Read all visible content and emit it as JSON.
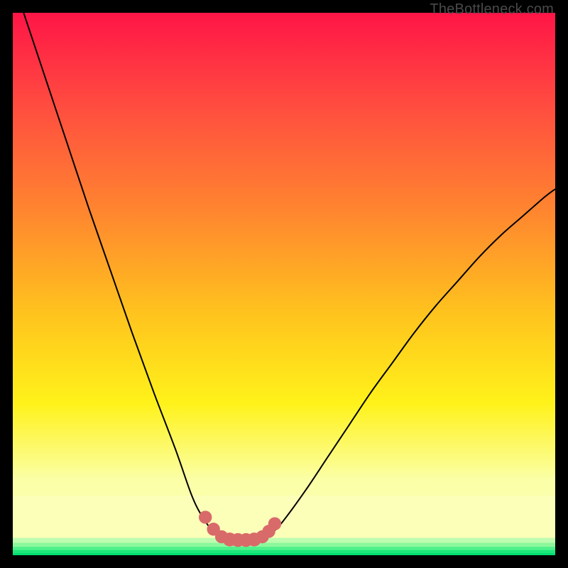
{
  "watermark": "TheBottleneck.com",
  "chart_data": {
    "type": "line",
    "title": "",
    "xlabel": "",
    "ylabel": "",
    "xlim": [
      0,
      100
    ],
    "ylim": [
      0,
      100
    ],
    "grid": false,
    "legend": false,
    "series": [
      {
        "name": "left-curve",
        "x": [
          2,
          6,
          10,
          14,
          18,
          22,
          26,
          30,
          33,
          35,
          37,
          38.5
        ],
        "y": [
          100,
          88,
          76,
          64,
          52.5,
          41,
          30,
          19.5,
          11,
          7,
          4.3,
          3.2
        ]
      },
      {
        "name": "right-curve",
        "x": [
          46,
          48,
          50,
          54,
          58,
          62,
          66,
          70,
          74,
          78,
          82,
          86,
          90,
          94,
          98,
          100
        ],
        "y": [
          3.2,
          4.3,
          6.5,
          12,
          18,
          24,
          30,
          35.5,
          41,
          46,
          50.5,
          55,
          59,
          62.5,
          66,
          67.5
        ]
      },
      {
        "name": "flat-bottom",
        "x": [
          38.5,
          40,
          41.5,
          43,
          44.5,
          46
        ],
        "y": [
          3.2,
          2.9,
          2.8,
          2.8,
          2.9,
          3.2
        ]
      }
    ],
    "markers": {
      "name": "bottom-dots",
      "color": "#d96a6a",
      "points": [
        {
          "x": 35.5,
          "y": 7.0,
          "r": 1.1
        },
        {
          "x": 37.0,
          "y": 4.8,
          "r": 1.1
        },
        {
          "x": 38.5,
          "y": 3.4,
          "r": 1.1
        },
        {
          "x": 40.0,
          "y": 2.9,
          "r": 1.25
        },
        {
          "x": 41.5,
          "y": 2.8,
          "r": 1.25
        },
        {
          "x": 43.0,
          "y": 2.8,
          "r": 1.25
        },
        {
          "x": 44.5,
          "y": 2.9,
          "r": 1.25
        },
        {
          "x": 46.0,
          "y": 3.4,
          "r": 1.1
        },
        {
          "x": 47.2,
          "y": 4.4,
          "r": 1.1
        },
        {
          "x": 48.3,
          "y": 5.8,
          "r": 1.1
        }
      ]
    },
    "bands": [
      {
        "name": "green-thin-1",
        "y0": 0.0,
        "y1": 0.5,
        "color": "#00df72"
      },
      {
        "name": "green-thin-2",
        "y0": 0.5,
        "y1": 1.0,
        "color": "#1de87a"
      },
      {
        "name": "green-thin-3",
        "y0": 1.0,
        "y1": 1.6,
        "color": "#4ff18b"
      },
      {
        "name": "green-thin-4",
        "y0": 1.6,
        "y1": 2.3,
        "color": "#8cf79b"
      },
      {
        "name": "green-thin-5",
        "y0": 2.3,
        "y1": 3.2,
        "color": "#befcb0"
      },
      {
        "name": "pale-yellow",
        "y0": 3.2,
        "y1": 11.0,
        "color": "#fbffb8"
      }
    ],
    "gradient_stops": [
      {
        "offset": 0,
        "color": "#ff1547"
      },
      {
        "offset": 18,
        "color": "#ff4f3f"
      },
      {
        "offset": 38,
        "color": "#ff8a2e"
      },
      {
        "offset": 55,
        "color": "#ffc21e"
      },
      {
        "offset": 72,
        "color": "#fff21a"
      },
      {
        "offset": 86,
        "color": "#fbffa6"
      },
      {
        "offset": 100,
        "color": "#fbffb8"
      }
    ]
  }
}
